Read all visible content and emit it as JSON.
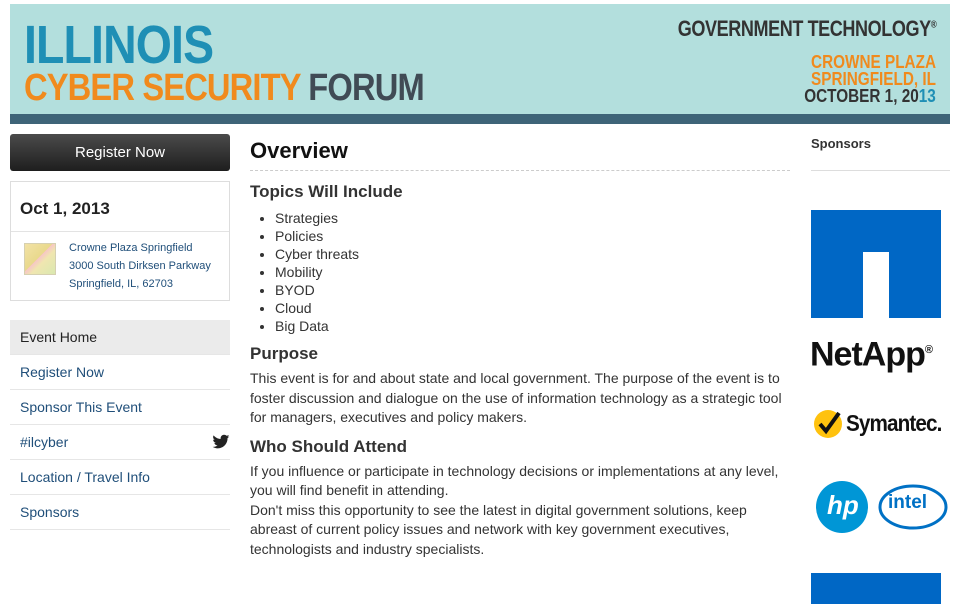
{
  "banner": {
    "illinois": "ILLINOIS",
    "cyber_security": "CYBER SECURITY",
    "forum": "FORUM",
    "publisher": "GOVERNMENT TECHNOLOGY",
    "publisher_mark": "®",
    "venue_line1": "CROWNE PLAZA",
    "venue_line2": "SPRINGFIELD, IL",
    "date_main": "OCTOBER 1, 20",
    "date_year_tail": "13"
  },
  "left": {
    "register_label": "Register Now",
    "date": "Oct 1, 2013",
    "address": [
      "Crowne Plaza Springfield",
      "3000 South Dirksen Parkway",
      "Springfield, IL, 62703"
    ],
    "nav": [
      {
        "label": "Event Home",
        "active": true
      },
      {
        "label": "Register Now",
        "active": false
      },
      {
        "label": "Sponsor This Event",
        "active": false
      },
      {
        "label": "#ilcyber",
        "active": false,
        "icon": "twitter-bird-icon"
      },
      {
        "label": "Location / Travel Info",
        "active": false
      },
      {
        "label": "Sponsors",
        "active": false
      }
    ]
  },
  "main": {
    "title": "Overview",
    "topics_heading": "Topics Will Include",
    "topics": [
      "Strategies",
      "Policies",
      "Cyber threats",
      "Mobility",
      "BYOD",
      "Cloud",
      "Big Data"
    ],
    "purpose_heading": "Purpose",
    "purpose_text": "This event is for and about state and local government. The purpose of the event is to foster discussion and dialogue on the use of information technology as a strategic tool for managers, executives and policy makers.",
    "attend_heading": "Who Should Attend",
    "attend_text1": "If you influence or participate in technology decisions or implementations at any level, you will find benefit in attending.",
    "attend_text2": "Don't miss this opportunity to see the latest in digital government solutions, keep abreast of current policy issues and network with key government executives, technologists and industry specialists."
  },
  "sponsors": {
    "heading": "Sponsors",
    "netapp": "NetApp",
    "netapp_mark": "®",
    "symantec": "Symantec.",
    "hp": "hp",
    "intel": "intel",
    "colors": {
      "netapp_blue": "#0067c5",
      "symantec_yellow": "#ffc20e",
      "hp_blue": "#0096d6",
      "intel_blue": "#0071c5"
    }
  },
  "colors": {
    "banner_bg": "#b3dfdd",
    "banner_bar": "#3e6478",
    "title_blue": "#1f8fb5",
    "title_orange": "#f08a1d",
    "link": "#1f4e79"
  }
}
